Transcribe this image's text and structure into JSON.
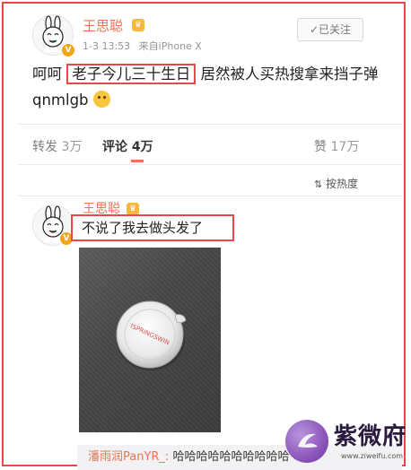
{
  "post": {
    "author": "王思聪",
    "time": "1-3 13:53",
    "source": "来自iPhone X",
    "follow_label": "✓已关注",
    "text_before": "呵呵",
    "text_highlight": "老子今儿三十生日",
    "text_after": "居然被人买热搜拿来挡子弹 qnmlgb"
  },
  "stats": {
    "repost_label": "转发",
    "repost_count": "3万",
    "comment_label": "评论",
    "comment_count": "4万",
    "like_label": "赞",
    "like_count": "17万"
  },
  "sort_label": "按热度",
  "comment": {
    "author": "王思聪",
    "text": "不说了我去做头发了",
    "photo_text": "ISPRINGSWIN"
  },
  "reply": {
    "name": "潘雨润PanYR_:",
    "text": "哈哈哈哈哈哈哈哈哈哈"
  },
  "watermark": {
    "text": "紫微府",
    "url": "www.ziweifu.com"
  },
  "colors": {
    "name": "#eb7350",
    "highlight_border": "#e8474c",
    "verified_badge": "#f3a51b"
  }
}
